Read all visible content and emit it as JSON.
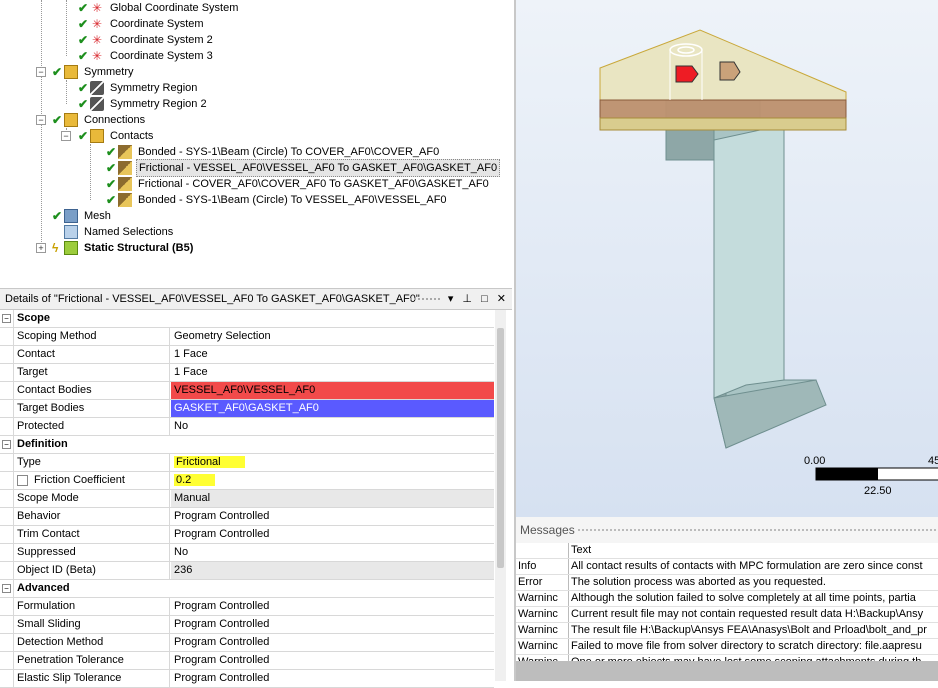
{
  "tree": {
    "items": [
      {
        "label": "Global Coordinate System",
        "icon": "coordinate-system-icon"
      },
      {
        "label": "Coordinate System",
        "icon": "coordinate-system-icon"
      },
      {
        "label": "Coordinate System 2",
        "icon": "coordinate-system-icon"
      },
      {
        "label": "Coordinate System 3",
        "icon": "coordinate-system-icon"
      },
      {
        "label": "Symmetry",
        "icon": "symmetry-folder-icon"
      },
      {
        "label": "Symmetry Region",
        "icon": "symmetry-region-icon"
      },
      {
        "label": "Symmetry Region 2",
        "icon": "symmetry-region-icon"
      },
      {
        "label": "Connections",
        "icon": "connections-folder-icon"
      },
      {
        "label": "Contacts",
        "icon": "contacts-folder-icon"
      },
      {
        "label": "Bonded - SYS-1\\Beam (Circle) To COVER_AF0\\COVER_AF0",
        "icon": "contact-region-icon"
      },
      {
        "label": "Frictional - VESSEL_AF0\\VESSEL_AF0 To GASKET_AF0\\GASKET_AF0",
        "icon": "contact-region-icon"
      },
      {
        "label": "Frictional - COVER_AF0\\COVER_AF0 To GASKET_AF0\\GASKET_AF0",
        "icon": "contact-region-icon"
      },
      {
        "label": "Bonded - SYS-1\\Beam (Circle) To VESSEL_AF0\\VESSEL_AF0",
        "icon": "contact-region-icon"
      },
      {
        "label": "Mesh",
        "icon": "mesh-icon"
      },
      {
        "label": "Named Selections",
        "icon": "named-selections-icon"
      },
      {
        "label": "Static Structural (B5)",
        "icon": "static-structural-icon"
      }
    ]
  },
  "details": {
    "title": "Details of \"Frictional - VESSEL_AF0\\VESSEL_AF0 To GASKET_AF0\\GASKET_AF0\"",
    "sections": {
      "scope": "Scope",
      "definition": "Definition",
      "advanced": "Advanced"
    },
    "rows": {
      "scoping_method": [
        "Scoping Method",
        "Geometry Selection"
      ],
      "contact": [
        "Contact",
        "1 Face"
      ],
      "target": [
        "Target",
        "1 Face"
      ],
      "contact_bodies": [
        "Contact Bodies",
        "VESSEL_AF0\\VESSEL_AF0"
      ],
      "target_bodies": [
        "Target Bodies",
        "GASKET_AF0\\GASKET_AF0"
      ],
      "protected": [
        "Protected",
        "No"
      ],
      "type": [
        "Type",
        "Frictional"
      ],
      "friction_coefficient": [
        "Friction Coefficient",
        "0.2"
      ],
      "scope_mode": [
        "Scope Mode",
        "Manual"
      ],
      "behavior": [
        "Behavior",
        "Program Controlled"
      ],
      "trim_contact": [
        "Trim Contact",
        "Program Controlled"
      ],
      "suppressed": [
        "Suppressed",
        "No"
      ],
      "object_id": [
        "Object ID (Beta)",
        "236"
      ],
      "formulation": [
        "Formulation",
        "Program Controlled"
      ],
      "small_sliding": [
        "Small Sliding",
        "Program Controlled"
      ],
      "detection_method": [
        "Detection Method",
        "Program Controlled"
      ],
      "penetration_tolerance": [
        "Penetration Tolerance",
        "Program Controlled"
      ],
      "elastic_slip_tolerance": [
        "Elastic Slip Tolerance",
        "Program Controlled"
      ]
    },
    "colors": {
      "contact": "#f24a4a",
      "target": "#5a5aff",
      "highlight": "#ffff33"
    }
  },
  "scale_bar": {
    "start": "0.00",
    "end": "45",
    "mid": "22.50"
  },
  "messages": {
    "title": "Messages",
    "column": "Text",
    "rows": [
      {
        "type": "Info",
        "text": "All contact results of contacts with MPC formulation are zero since const"
      },
      {
        "type": "Error",
        "text": "The solution process was aborted as you requested."
      },
      {
        "type": "Warninc",
        "text": "Although the solution failed to solve completely at all time points, partia"
      },
      {
        "type": "Warninc",
        "text": "Current result file may not contain requested result data H:\\Backup\\Ansy"
      },
      {
        "type": "Warninc",
        "text": "The result file H:\\Backup\\Ansys FEA\\Anasys\\Bolt and Prload\\bolt_and_pr"
      },
      {
        "type": "Warninc",
        "text": "Failed to move file from solver directory to scratch directory: file.aapresu"
      },
      {
        "type": "Warninc",
        "text": "One or more objects may have lost some scoping attachments during th"
      }
    ]
  }
}
